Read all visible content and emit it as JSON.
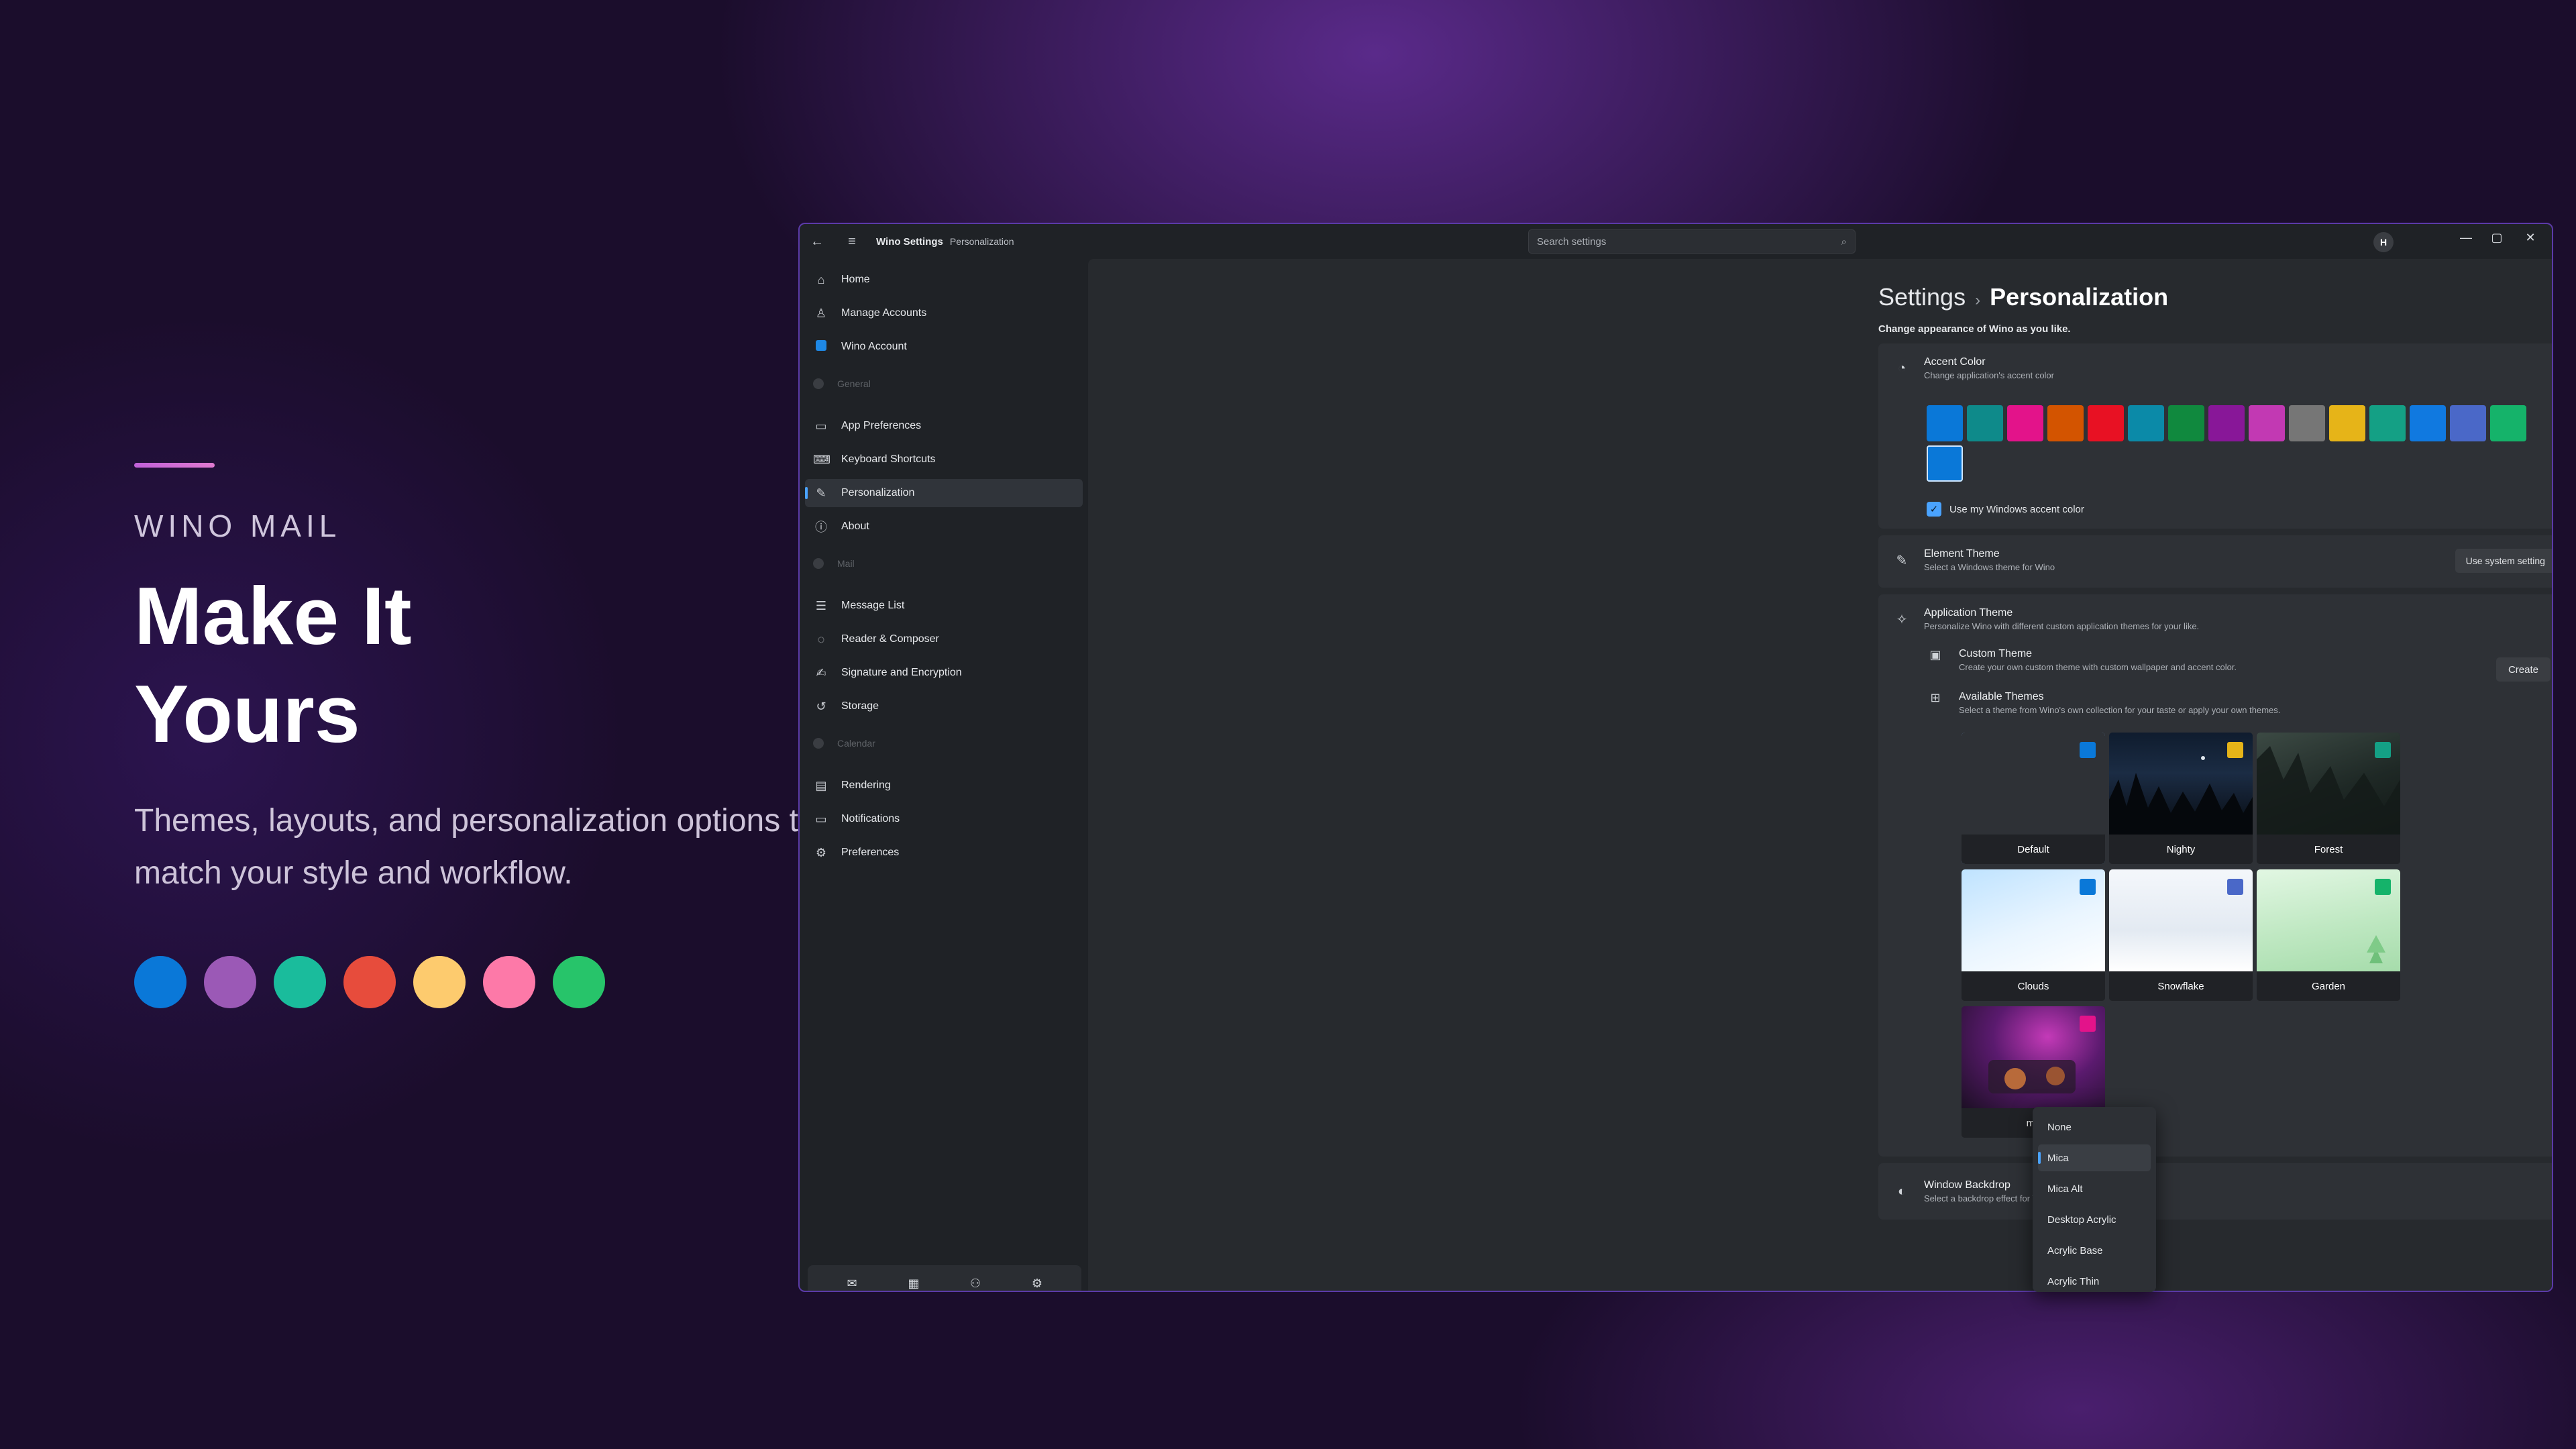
{
  "hero": {
    "brand": "WINO MAIL",
    "title_line1": "Make It",
    "title_line2": "Yours",
    "subtitle": "Themes, layouts, and personalization options to match your style and workflow.",
    "swatch_colors": [
      "#0a78d8",
      "#9b59b6",
      "#1abc9c",
      "#e74c3c",
      "#fdcb6e",
      "#fd79a8",
      "#27c46a"
    ]
  },
  "titlebar": {
    "app_title": "Wino Settings",
    "breadcrumb": "Personalization",
    "search_placeholder": "Search settings",
    "avatar_initial": "H",
    "icons": [
      "back-arrow-icon",
      "hamburger-menu-icon",
      "search-icon",
      "minimize-icon",
      "maximize-icon",
      "close-icon"
    ]
  },
  "sidebar": {
    "items": [
      {
        "label": "Home",
        "icon": "home-icon"
      },
      {
        "label": "Manage Accounts",
        "icon": "person-icon"
      },
      {
        "label": "Wino Account",
        "icon": "wino-logo-icon"
      },
      {
        "label": "App Preferences",
        "icon": "laptop-icon"
      },
      {
        "label": "Keyboard Shortcuts",
        "icon": "keyboard-icon"
      },
      {
        "label": "Personalization",
        "icon": "pen-icon",
        "active": true
      },
      {
        "label": "About",
        "icon": "info-icon"
      },
      {
        "label": "Message List",
        "icon": "list-icon"
      },
      {
        "label": "Reader & Composer",
        "icon": "chat-icon"
      },
      {
        "label": "Signature and Encryption",
        "icon": "signature-icon"
      },
      {
        "label": "Storage",
        "icon": "history-icon"
      },
      {
        "label": "Rendering",
        "icon": "document-icon"
      },
      {
        "label": "Notifications",
        "icon": "monitor-icon"
      },
      {
        "label": "Preferences",
        "icon": "gear-icon"
      }
    ],
    "headers": {
      "general": "General",
      "mail": "Mail",
      "calendar": "Calendar"
    },
    "bottom_icons": [
      "mail-icon",
      "calendar-icon",
      "people-icon",
      "settings-icon"
    ],
    "accent": "#4aa3ff"
  },
  "page": {
    "root": "Settings",
    "separator": "›",
    "current": "Personalization",
    "description": "Change appearance of Wino as you like."
  },
  "accent_card": {
    "title": "Accent Color",
    "description": "Change application's accent color",
    "colors": [
      "#0a78d8",
      "#0e8a8a",
      "#e3138a",
      "#d35400",
      "#e81123",
      "#0b8aa8",
      "#10893e",
      "#881798",
      "#c239b3",
      "#767676",
      "#e6b418",
      "#14a085",
      "#1079e0",
      "#4a68c8",
      "#15b36a",
      "#0a78d8"
    ],
    "selected_index": 15,
    "checkbox_label": "Use my Windows accent color",
    "checkbox_checked": true
  },
  "element_theme": {
    "title": "Element Theme",
    "description": "Select a Windows theme for Wino",
    "dropdown_value": "Use system setting"
  },
  "application_theme": {
    "title": "Application Theme",
    "description": "Personalize Wino with different custom application themes for your like.",
    "custom": {
      "title": "Custom Theme",
      "description": "Create your own custom theme with custom wallpaper and accent color.",
      "button": "Create"
    },
    "available": {
      "title": "Available Themes",
      "description": "Select a theme from Wino's own collection for your taste or apply your own themes."
    },
    "themes": [
      {
        "name": "Default",
        "accent": "#0a78d8",
        "selected": true
      },
      {
        "name": "Nighty",
        "accent": "#e6b418"
      },
      {
        "name": "Forest",
        "accent": "#14a085"
      },
      {
        "name": "Clouds",
        "accent": "#0a78d8"
      },
      {
        "name": "Snowflake",
        "accent": "#4a68c8"
      },
      {
        "name": "Garden",
        "accent": "#15b36a"
      },
      {
        "name": "me",
        "accent": "#e3138a"
      }
    ]
  },
  "window_backdrop": {
    "title": "Window Backdrop",
    "description": "Select a backdrop effect for Wino windows.",
    "options": [
      "None",
      "Mica",
      "Mica Alt",
      "Desktop Acrylic",
      "Acrylic Base",
      "Acrylic Thin"
    ],
    "selected": "Mica"
  }
}
